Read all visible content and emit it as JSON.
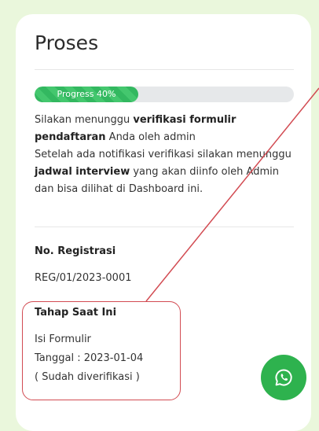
{
  "page": {
    "title": "Proses"
  },
  "progress": {
    "label": "Progress 40%",
    "value": 0.4,
    "color": "#33b860"
  },
  "description": {
    "line1_a": "Silakan menunggu ",
    "line1_bold": "verifikasi formulir pendaftaran",
    "line1_b": " Anda oleh admin",
    "line2_a": "Setelah ada notifikasi verifikasi silakan menunggu ",
    "line2_bold": "jadwal interview",
    "line2_b": " yang akan diinfo oleh Admin dan bisa dilihat di Dashboard ini."
  },
  "registration": {
    "label": "No. Registrasi",
    "value": "REG/01/2023-0001"
  },
  "stage": {
    "label": "Tahap Saat Ini",
    "name": "Isi Formulir",
    "date": "Tanggal : 2023-01-04",
    "status": "( Sudah diverifikasi )"
  },
  "fab": {
    "icon": "whatsapp-icon",
    "color": "#2eb24e"
  },
  "annotation": {
    "color": "#d24b52"
  }
}
